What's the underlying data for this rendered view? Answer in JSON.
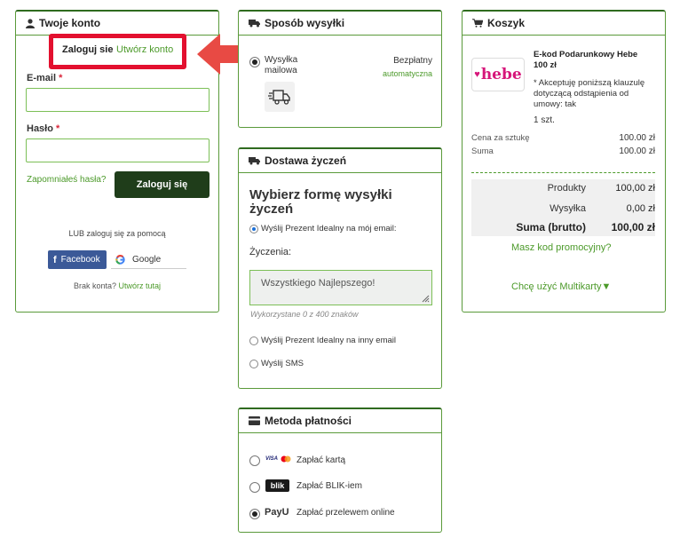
{
  "account": {
    "title": "Twoje konto",
    "tab_login": "Zaloguj sie",
    "tab_register": "Utwórz konto",
    "email_label": "E-mail",
    "password_label": "Hasło",
    "required_mark": "*",
    "forgot": "Zapomniałeś hasła?",
    "login_button": "Zaloguj się",
    "social_intro": "LUB zaloguj się za pomocą",
    "facebook": "Facebook",
    "google": "Google",
    "no_account": "Brak konta?",
    "create_here": "Utwórz tutaj"
  },
  "shipping": {
    "title": "Sposób wysyłki",
    "option_label": "Wysyłka mailowa",
    "price": "Bezpłatny",
    "auto": "automatyczna"
  },
  "wishes": {
    "title": "Dostawa życzeń",
    "heading": "Wybierz formę wysyłki życzeń",
    "option1": "Wyślij Prezent Idealny na mój email:",
    "wishes_label": "Życzenia:",
    "wishes_value": "Wszystkiego Najlepszego!",
    "counter": "Wykorzystane 0 z 400 znaków",
    "option2": "Wyślij Prezent Idealny na inny email",
    "option3": "Wyślij SMS"
  },
  "payment": {
    "title": "Metoda płatności",
    "card_logo": "VISA",
    "card": "Zapłać kartą",
    "blik_logo": "blik",
    "blik": "Zapłać BLIK-iem",
    "payu_logo": "PayU",
    "transfer": "Zapłać przelewem online"
  },
  "cart": {
    "title": "Koszyk",
    "brand_logo": "hebe",
    "product_name": "E-kod Podarunkowy Hebe 100 zł",
    "terms": "* Akceptuję poniższą klauzulę dotyczącą odstąpienia od umowy: tak",
    "qty": "1 szt.",
    "unit_price_label": "Cena za sztukę",
    "unit_price": "100.00 zł",
    "sum_label": "Suma",
    "sum": "100.00 zł",
    "products_label": "Produkty",
    "products_value": "100,00 zł",
    "shipping_label": "Wysyłka",
    "shipping_value": "0,00 zł",
    "total_label": "Suma (brutto)",
    "total_value": "100,00 zł",
    "promo": "Masz kod promocyjny?",
    "multikarta": "Chcę użyć Multikarty▼"
  },
  "colors": {
    "accent_green": "#4c9a2a",
    "dark_button": "#1f3d1a",
    "highlight_red": "#e3102f"
  }
}
